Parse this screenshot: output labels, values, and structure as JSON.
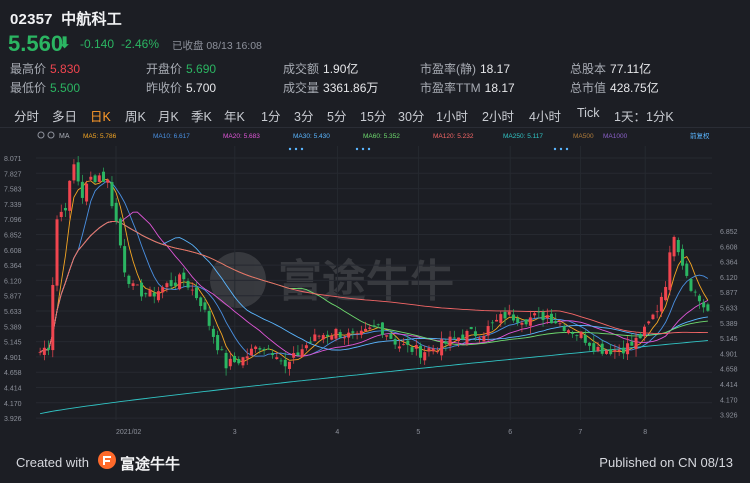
{
  "header": {
    "code": "02357",
    "name": "中航科工",
    "price": "5.560",
    "arrow": "⬇",
    "change": "-0.140",
    "change_pct": "-2.46%",
    "status": "已收盘 08/13 16:08"
  },
  "stats": {
    "high_label": "最高价",
    "high": "5.830",
    "low_label": "最低价",
    "low": "5.500",
    "open_label": "开盘价",
    "open": "5.690",
    "prev_label": "昨收价",
    "prev": "5.700",
    "amount_label": "成交额",
    "amount": "1.90亿",
    "volume_label": "成交量",
    "volume": "3361.86万",
    "pe_static_label": "市盈率(静)",
    "pe_static": "18.17",
    "pe_ttm_label": "市盈率TTM",
    "pe_ttm": "18.17",
    "shares_label": "总股本",
    "shares": "77.11亿",
    "mcap_label": "总市值",
    "mcap": "428.75亿"
  },
  "tabs": [
    "分时",
    "多日",
    "日K",
    "周K",
    "月K",
    "季K",
    "年K",
    "1分",
    "3分",
    "5分",
    "15分",
    "30分",
    "1小时",
    "2小时",
    "4小时",
    "Tick",
    "1天：1分K"
  ],
  "active_tab": 2,
  "footer": {
    "created_with": "Created with",
    "brand": "富途牛牛",
    "published": "Published on CN 08/13"
  },
  "colors": {
    "up": "#f0454f",
    "down": "#2bb562",
    "accent": "#ff9b2a",
    "ma5": "#f5a623",
    "ma10": "#4a90e2",
    "ma20": "#e056d8",
    "ma30": "#5ab6ff",
    "ma60": "#6fdc6f",
    "ma120": "#f66767",
    "ma250": "#31c4c4"
  },
  "chart_data": {
    "type": "candlestick",
    "legend": [
      {
        "name": "MA5",
        "value": "5.786",
        "color": "#f5a623"
      },
      {
        "name": "MA10",
        "value": "6.617",
        "color": "#4a90e2"
      },
      {
        "name": "MA20",
        "value": "5.683",
        "color": "#e056d8"
      },
      {
        "name": "MA30",
        "value": "5.430",
        "color": "#5ab6ff"
      },
      {
        "name": "MA60",
        "value": "5.352",
        "color": "#6fdc6f"
      },
      {
        "name": "MA120",
        "value": "5.232",
        "color": "#f66767"
      },
      {
        "name": "MA250",
        "value": "5.117",
        "color": "#31c4c4"
      },
      {
        "name": "MA500",
        "value": "",
        "color": "#b07c3a"
      },
      {
        "name": "MA1000",
        "value": "",
        "color": "#8a60c8"
      }
    ],
    "ma_label": "MA",
    "adjust_label": "前复权",
    "y_ticks": [
      "8.071",
      "7.827",
      "7.583",
      "7.339",
      "7.096",
      "6.852",
      "6.608",
      "6.364",
      "6.120",
      "5.877",
      "5.633",
      "5.389",
      "5.145",
      "4.901",
      "4.658",
      "4.414",
      "4.170",
      "3.926"
    ],
    "right_ticks": [
      "6.852",
      "6.608",
      "6.364",
      "6.120",
      "5.877",
      "5.633",
      "5.389",
      "5.145",
      "4.901",
      "4.658",
      "4.414",
      "4.170",
      "3.926"
    ],
    "x_labels": [
      {
        "label": "2021/02",
        "pos": 0.0
      },
      {
        "label": "3",
        "pos": 0.22
      },
      {
        "label": "4",
        "pos": 0.41
      },
      {
        "label": "5",
        "pos": 0.56
      },
      {
        "label": "6",
        "pos": 0.73
      },
      {
        "label": "7",
        "pos": 0.86
      },
      {
        "label": "8",
        "pos": 0.98
      }
    ],
    "ylim": [
      3.926,
      8.071
    ],
    "anchors": [
      [
        0,
        4.95
      ],
      [
        2,
        5.05
      ],
      [
        4,
        6.95
      ],
      [
        6,
        7.15
      ],
      [
        8,
        7.75
      ],
      [
        10,
        7.3
      ],
      [
        12,
        7.55
      ],
      [
        14,
        7.6
      ],
      [
        16,
        7.5
      ],
      [
        18,
        6.9
      ],
      [
        20,
        6.2
      ],
      [
        22,
        5.9
      ],
      [
        26,
        5.8
      ],
      [
        30,
        5.95
      ],
      [
        34,
        6.05
      ],
      [
        38,
        5.7
      ],
      [
        41,
        5.2
      ],
      [
        44,
        4.75
      ],
      [
        48,
        4.85
      ],
      [
        52,
        5.05
      ],
      [
        56,
        4.95
      ],
      [
        58,
        4.7
      ],
      [
        62,
        5.0
      ],
      [
        66,
        5.2
      ],
      [
        70,
        5.25
      ],
      [
        75,
        5.15
      ],
      [
        80,
        5.35
      ],
      [
        85,
        5.05
      ],
      [
        90,
        4.95
      ],
      [
        95,
        5.05
      ],
      [
        100,
        5.2
      ],
      [
        105,
        5.25
      ],
      [
        110,
        5.5
      ],
      [
        115,
        5.45
      ],
      [
        120,
        5.5
      ],
      [
        125,
        5.3
      ],
      [
        128,
        5.2
      ],
      [
        132,
        5.0
      ],
      [
        136,
        4.98
      ],
      [
        140,
        5.05
      ],
      [
        143,
        5.25
      ],
      [
        146,
        5.6
      ],
      [
        148,
        6.0
      ],
      [
        150,
        6.75
      ],
      [
        152,
        6.3
      ],
      [
        154,
        5.95
      ],
      [
        156,
        5.72
      ],
      [
        158,
        5.56
      ]
    ]
  }
}
